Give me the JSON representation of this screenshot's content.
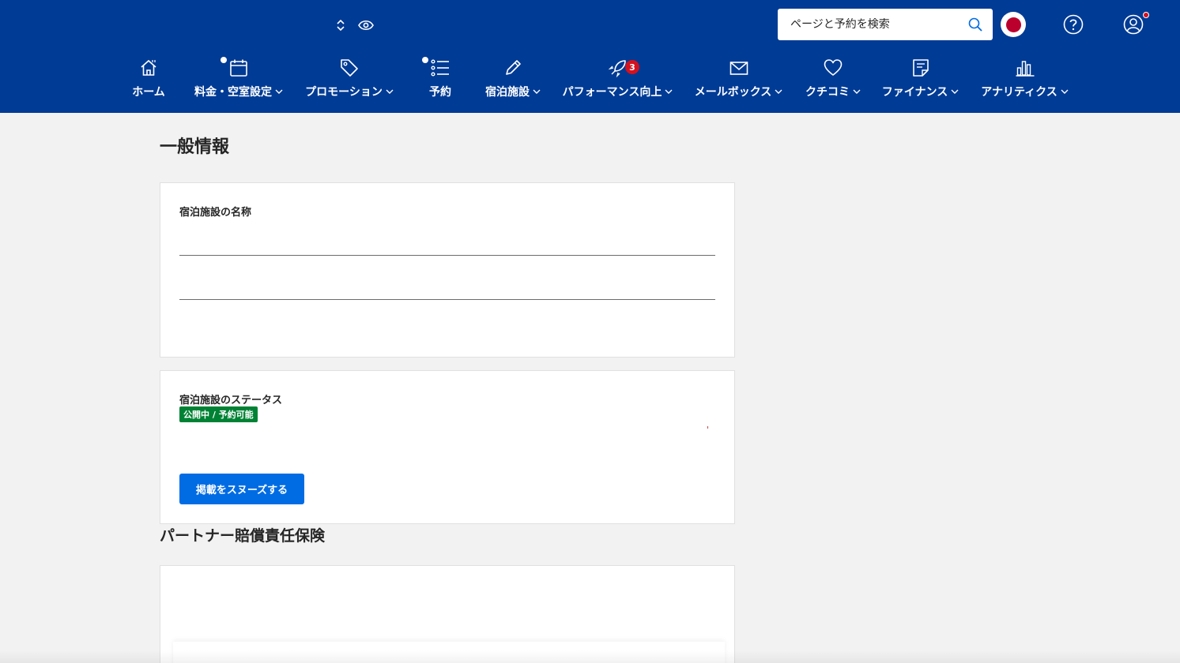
{
  "header": {
    "search": {
      "placeholder": "ページと予約を検索"
    },
    "language": {
      "flag_colors": {
        "circle": "#bc002d",
        "field": "#ffffff"
      }
    },
    "icons": {
      "property_switcher": "chevron-up-down-icon",
      "preview": "eye-icon",
      "search": "search-icon",
      "help": "question-circle-icon",
      "account": "user-circle-icon"
    },
    "account_notification": true
  },
  "nav": {
    "items": [
      {
        "label": "ホーム",
        "icon": "home-icon",
        "dropdown": false
      },
      {
        "label": "料金・空室設定",
        "icon": "calendar-icon",
        "dropdown": true,
        "dot": true
      },
      {
        "label": "プロモーション",
        "icon": "tag-icon",
        "dropdown": true
      },
      {
        "label": "予約",
        "icon": "list-icon",
        "dropdown": false,
        "dot": true
      },
      {
        "label": "宿泊施設",
        "icon": "pencil-icon",
        "dropdown": true
      },
      {
        "label": "パフォーマンス向上",
        "icon": "rocket-icon",
        "dropdown": true,
        "badge": "3"
      },
      {
        "label": "メールボックス",
        "icon": "envelope-icon",
        "dropdown": true
      },
      {
        "label": "クチコミ",
        "icon": "heart-icon",
        "dropdown": true
      },
      {
        "label": "ファイナンス",
        "icon": "invoice-icon",
        "dropdown": true
      },
      {
        "label": "アナリティクス",
        "icon": "bar-chart-icon",
        "dropdown": true
      }
    ]
  },
  "main": {
    "page_title": "一般情報",
    "property_name_card": {
      "label": "宿泊施設の名称"
    },
    "status_card": {
      "label": "宿泊施設のステータス",
      "status_badge": "公開中 / 予約可能",
      "snooze_button": "掲載をスヌーズする"
    },
    "insurance_section": {
      "title": "パートナー賠償責任保険"
    }
  },
  "colors": {
    "header_bg": "#003b95",
    "page_bg": "#f2f2f2",
    "primary_button": "#006ce4",
    "status_green": "#008234",
    "badge_red": "#d4111e"
  }
}
